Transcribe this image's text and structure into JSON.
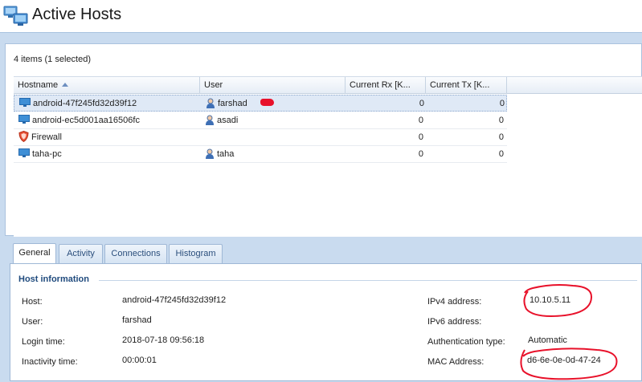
{
  "header": {
    "title": "Active Hosts",
    "icon": "monitor-network-icon"
  },
  "list": {
    "items_count": "4 items (1 selected)",
    "columns": [
      {
        "label": "Hostname",
        "sorted": "ascending"
      },
      {
        "label": "User"
      },
      {
        "label": "Current Rx [K..."
      },
      {
        "label": "Current Tx [K..."
      }
    ],
    "rows": [
      {
        "hostname": "android-47f245fd32d39f12",
        "host_icon": "monitor-icon",
        "user": "farshad",
        "user_icon": "user-icon",
        "rx": "0",
        "tx": "0",
        "selected": true
      },
      {
        "hostname": "android-ec5d001aa16506fc",
        "host_icon": "monitor-icon",
        "user": "asadi",
        "user_icon": "user-icon",
        "rx": "0",
        "tx": "0",
        "selected": false
      },
      {
        "hostname": "Firewall",
        "host_icon": "firewall-shield-icon",
        "user": "",
        "user_icon": "",
        "rx": "0",
        "tx": "0",
        "selected": false
      },
      {
        "hostname": "taha-pc",
        "host_icon": "monitor-icon",
        "user": "taha",
        "user_icon": "user-icon",
        "rx": "0",
        "tx": "0",
        "selected": false
      }
    ]
  },
  "tabs": [
    {
      "label": "General",
      "active": true
    },
    {
      "label": "Activity",
      "active": false
    },
    {
      "label": "Connections",
      "active": false
    },
    {
      "label": "Histogram",
      "active": false
    }
  ],
  "host_info": {
    "section_title": "Host information",
    "host_label": "Host:",
    "host_value": "android-47f245fd32d39f12",
    "user_label": "User:",
    "user_value": "farshad",
    "login_label": "Login time:",
    "login_value": "2018-07-18 09:56:18",
    "inactivity_label": "Inactivity time:",
    "inactivity_value": "00:00:01",
    "ipv4_label": "IPv4 address:",
    "ipv4_value": "10.10.5.11",
    "ipv6_label": "IPv6 address:",
    "ipv6_value": "",
    "auth_label": "Authentication type:",
    "auth_value": "Automatic",
    "mac_label": "MAC Address:",
    "mac_value": "d6-6e-0e-0d-47-24"
  },
  "colors": {
    "annotation_red": "#e8112a",
    "section_title": "#1f4a7d",
    "selected_row": "#dfe9f6"
  }
}
